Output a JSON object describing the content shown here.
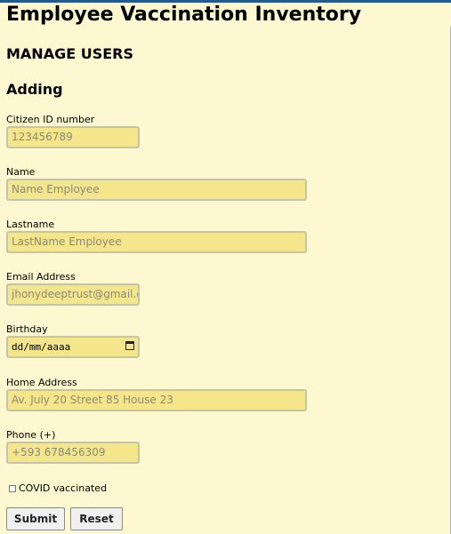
{
  "app": {
    "title": "Employee Vaccination Inventory"
  },
  "section": {
    "title": "MANAGE USERS",
    "subtitle": "Adding"
  },
  "form": {
    "fields": [
      {
        "label": "Citizen ID number",
        "placeholder": "123456789"
      },
      {
        "label": "Name",
        "placeholder": "Name Employee"
      },
      {
        "label": "Lastname",
        "placeholder": "LastName Employee"
      },
      {
        "label": "Email Address",
        "placeholder": "jhonydeeptrust@gmail.co"
      },
      {
        "label": "Birthday",
        "placeholder": "dd/mm/aaaa"
      },
      {
        "label": "Home Address",
        "placeholder": "Av. July 20 Street 85 House 23"
      },
      {
        "label": "Phone (+)",
        "placeholder": "+593 678456309"
      }
    ],
    "checkbox": {
      "label": "COVID vaccinated",
      "checked": false
    },
    "buttons": {
      "submit": "Submit",
      "reset": "Reset"
    }
  },
  "colors": {
    "background": "#fdf8cf",
    "input_fill": "#f5e68c",
    "top_bar": "#1f5c8f"
  }
}
